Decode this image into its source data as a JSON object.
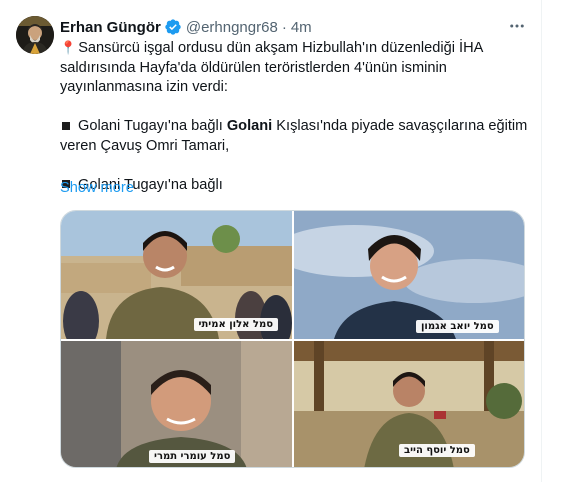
{
  "tweet": {
    "author": {
      "display_name": "Erhan Güngör",
      "handle": "@erhngngr68",
      "verified": true,
      "avatar_icon": "profile-photo"
    },
    "separator": "·",
    "time": "4m",
    "more_icon": "ellipsis-horizontal-icon",
    "lines": {
      "l1": "Sansürcü işgal ordusu dün akşam Hizbullah'ın düzenlediği İHA",
      "l2": "saldırısında Hayfa'da öldürülen teröristlerden 4'ünün isminin",
      "l3": "yayınlanmasına izin verdi:",
      "b1_pre": "Golani Tugayı'na bağlı ",
      "b1_bold": "Golani",
      "b1_post": " Kışlası'nda piyade savaşçılarına eğitim",
      "b1_cont": "veren Çavuş Omri Tamari,",
      "b2": "Golani Tugayı'na bağlı"
    },
    "show_more": "Show more",
    "colors": {
      "link": "#1d9bf0",
      "verified": "#1d9bf0",
      "secondary_text": "#536471"
    },
    "media": {
      "images": [
        {
          "caption": "סמל אלון אמיתי"
        },
        {
          "caption": "סמל יואב אגמון"
        },
        {
          "caption": "סמל עומרי תמרי"
        },
        {
          "caption": "סמל יוסף הייב"
        }
      ]
    }
  }
}
